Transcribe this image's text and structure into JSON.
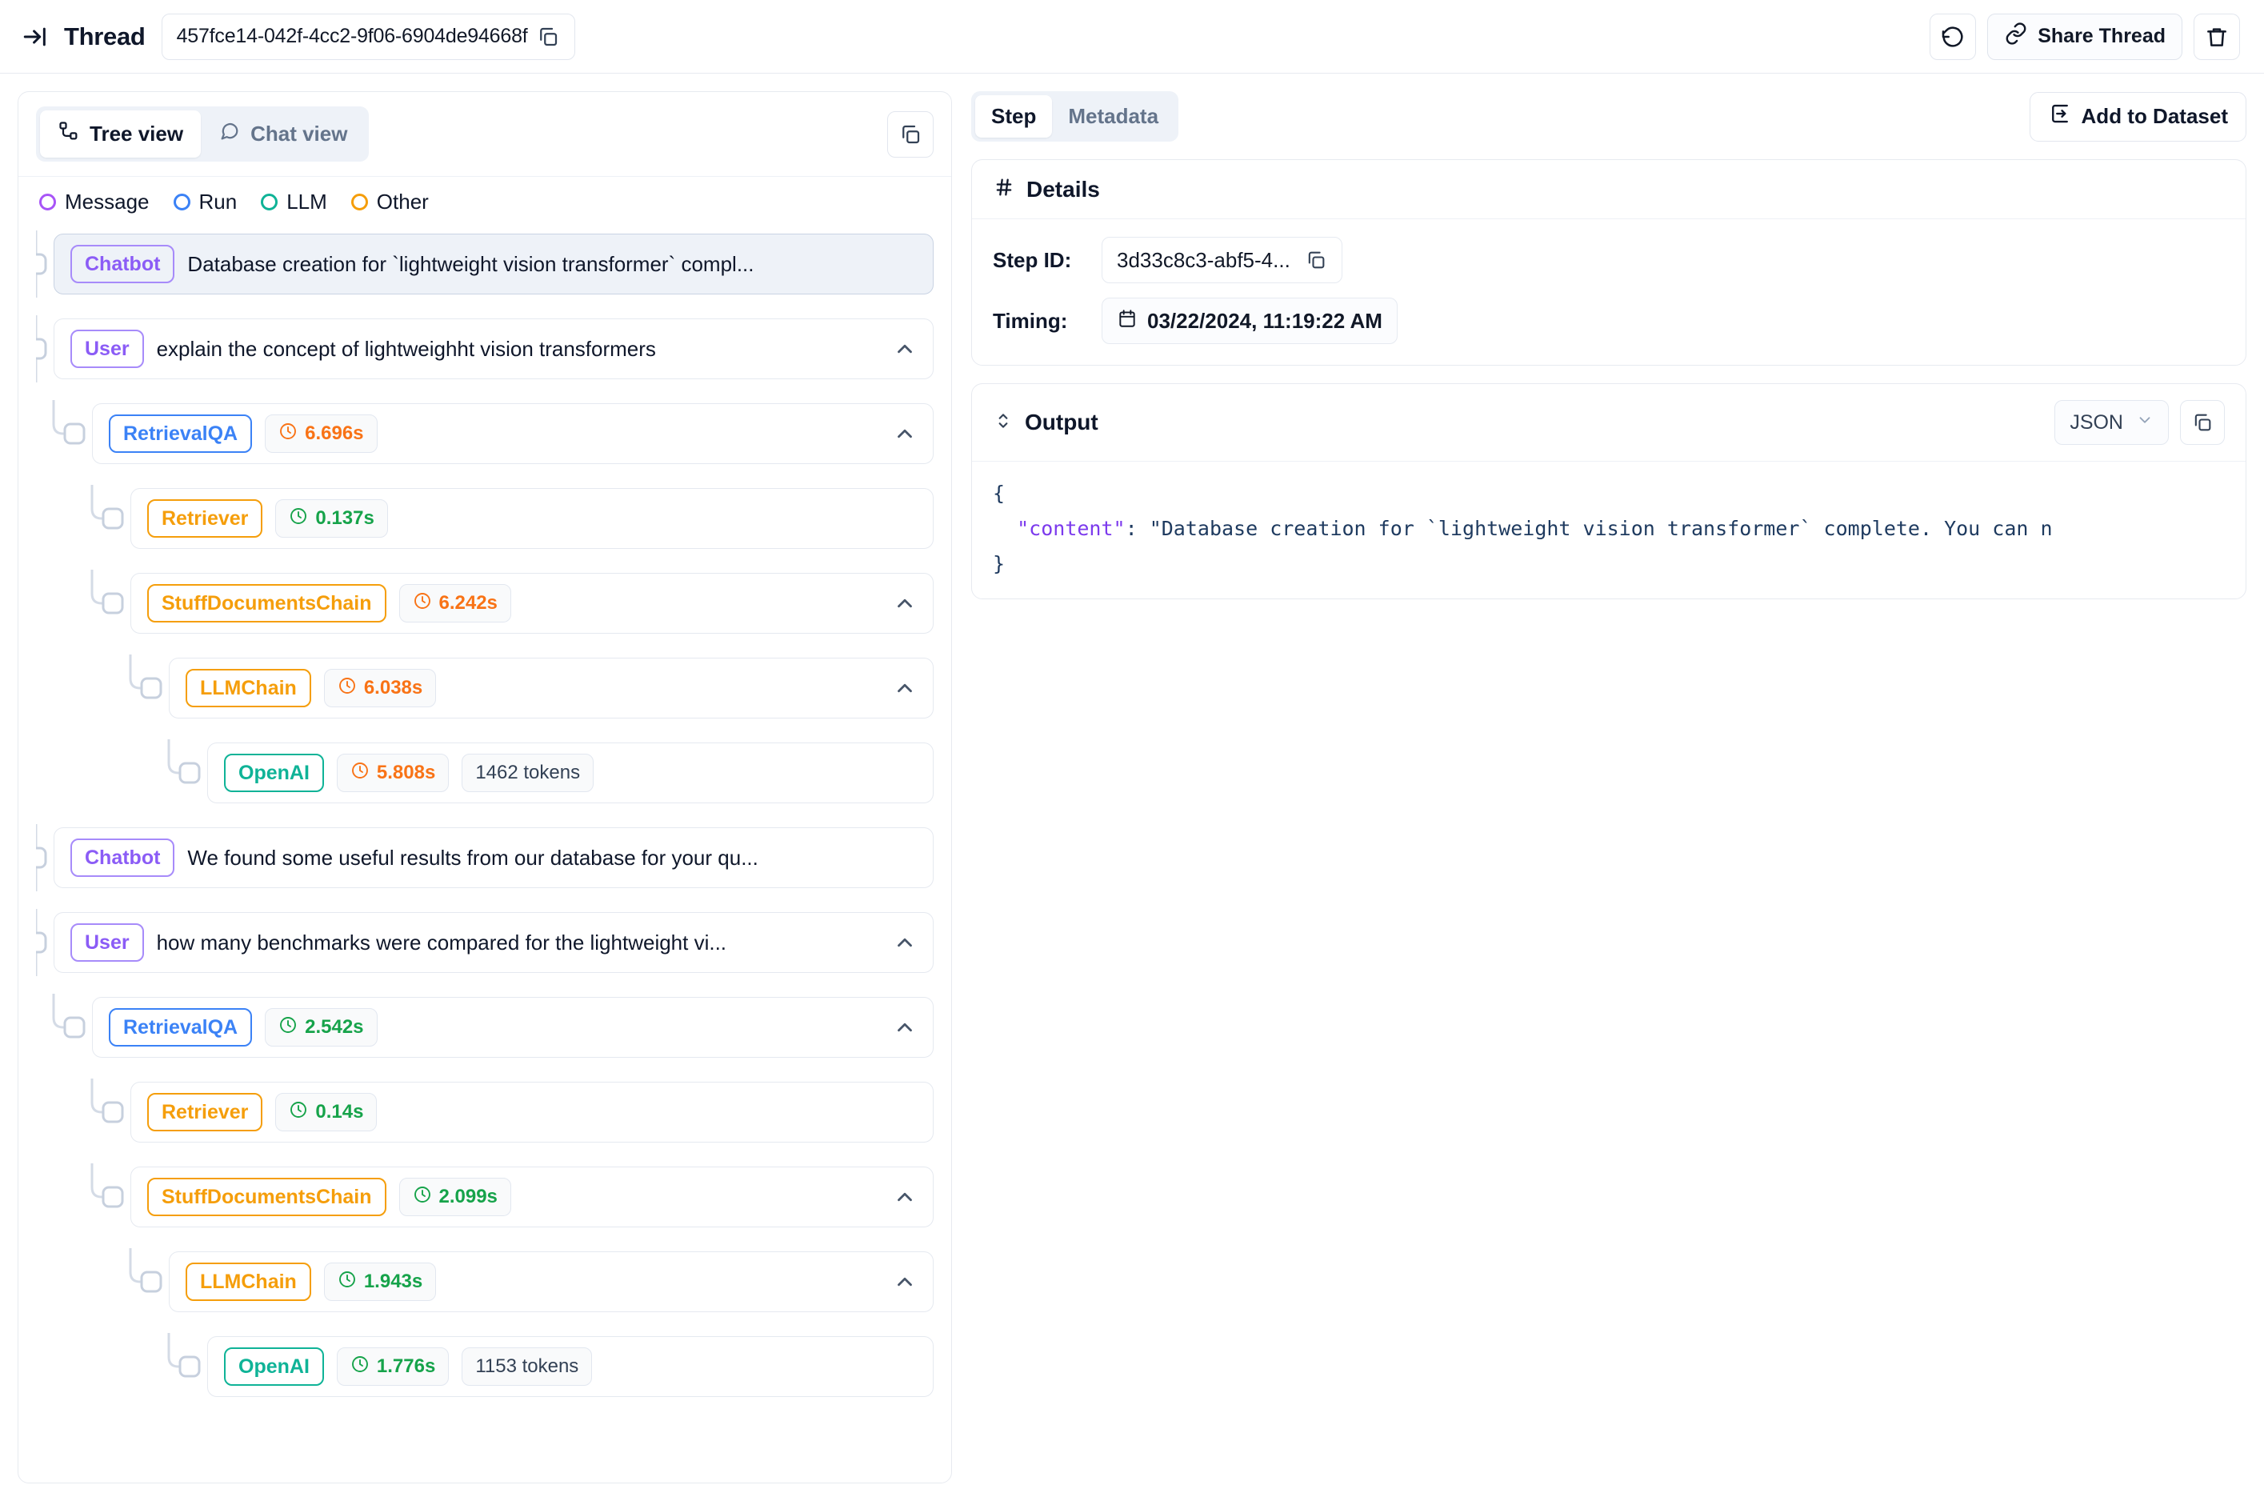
{
  "topbar": {
    "collapse_icon": "collapse-panel-icon",
    "title": "Thread",
    "thread_id": "457fce14-042f-4cc2-9f06-6904de94668f",
    "copy_icon": "copy-icon",
    "refresh_icon": "refresh-icon",
    "share_label": "Share Thread",
    "share_icon": "link-icon",
    "delete_icon": "trash-icon"
  },
  "left_panel": {
    "tabs": [
      {
        "label": "Tree view",
        "icon": "tree-icon",
        "active": true
      },
      {
        "label": "Chat view",
        "icon": "chat-bubble-icon",
        "active": false
      }
    ],
    "copy_icon": "copy-icon",
    "legend": [
      {
        "label": "Message",
        "color": "#a855f7"
      },
      {
        "label": "Run",
        "color": "#3b82f6"
      },
      {
        "label": "LLM",
        "color": "#0fb397"
      },
      {
        "label": "Other",
        "color": "#f59e0b"
      }
    ],
    "nodes": [
      {
        "tag": "Chatbot",
        "tag_kind": "message",
        "depth": 0,
        "selected": true,
        "text": "Database creation for `lightweight vision transformer` compl...",
        "chevron": false
      },
      {
        "tag": "User",
        "tag_kind": "message",
        "depth": 0,
        "selected": false,
        "text": "explain the concept of lightweighht vision transformers",
        "chevron": true
      },
      {
        "tag": "RetrievalQA",
        "tag_kind": "run",
        "depth": 1,
        "selected": false,
        "duration": "6.696s",
        "duration_color": "orange",
        "chevron": true
      },
      {
        "tag": "Retriever",
        "tag_kind": "other",
        "depth": 2,
        "selected": false,
        "duration": "0.137s",
        "duration_color": "green",
        "chevron": false
      },
      {
        "tag": "StuffDocumentsChain",
        "tag_kind": "other",
        "depth": 2,
        "selected": false,
        "duration": "6.242s",
        "duration_color": "orange",
        "chevron": true
      },
      {
        "tag": "LLMChain",
        "tag_kind": "other",
        "depth": 3,
        "selected": false,
        "duration": "6.038s",
        "duration_color": "orange",
        "chevron": true
      },
      {
        "tag": "OpenAI",
        "tag_kind": "llm",
        "depth": 4,
        "selected": false,
        "duration": "5.808s",
        "duration_color": "orange",
        "tokens": "1462 tokens",
        "chevron": false
      },
      {
        "tag": "Chatbot",
        "tag_kind": "message",
        "depth": 0,
        "selected": false,
        "text": "We found some useful results from our database for your qu...",
        "chevron": false
      },
      {
        "tag": "User",
        "tag_kind": "message",
        "depth": 0,
        "selected": false,
        "text": "how many benchmarks were compared for the lightweight vi...",
        "chevron": true
      },
      {
        "tag": "RetrievalQA",
        "tag_kind": "run",
        "depth": 1,
        "selected": false,
        "duration": "2.542s",
        "duration_color": "green",
        "chevron": true
      },
      {
        "tag": "Retriever",
        "tag_kind": "other",
        "depth": 2,
        "selected": false,
        "duration": "0.14s",
        "duration_color": "green",
        "chevron": false
      },
      {
        "tag": "StuffDocumentsChain",
        "tag_kind": "other",
        "depth": 2,
        "selected": false,
        "duration": "2.099s",
        "duration_color": "green",
        "chevron": true
      },
      {
        "tag": "LLMChain",
        "tag_kind": "other",
        "depth": 3,
        "selected": false,
        "duration": "1.943s",
        "duration_color": "green",
        "chevron": true
      },
      {
        "tag": "OpenAI",
        "tag_kind": "llm",
        "depth": 4,
        "selected": false,
        "duration": "1.776s",
        "duration_color": "green",
        "tokens": "1153 tokens",
        "chevron": false
      }
    ]
  },
  "right_panel": {
    "tabs": [
      {
        "label": "Step",
        "active": true
      },
      {
        "label": "Metadata",
        "active": false
      }
    ],
    "add_to_dataset_label": "Add to Dataset",
    "add_to_dataset_icon": "add-to-dataset-icon",
    "details": {
      "hash_icon": "hash-icon",
      "title": "Details",
      "step_id_label": "Step ID:",
      "step_id_value": "3d33c8c3-abf5-4...",
      "step_id_copy_icon": "copy-icon",
      "timing_label": "Timing:",
      "timing_icon": "calendar-icon",
      "timing_value": "03/22/2024, 11:19:22 AM"
    },
    "output": {
      "expand_icon": "expand-collapse-icon",
      "title": "Output",
      "format": "JSON",
      "format_chevron_icon": "chevron-down-icon",
      "copy_icon": "copy-icon",
      "code_open": "{",
      "code_key": "\"content\"",
      "code_colon": ": ",
      "code_value": "\"Database creation for `lightweight vision transformer` complete. You can n",
      "code_close": "}"
    }
  }
}
